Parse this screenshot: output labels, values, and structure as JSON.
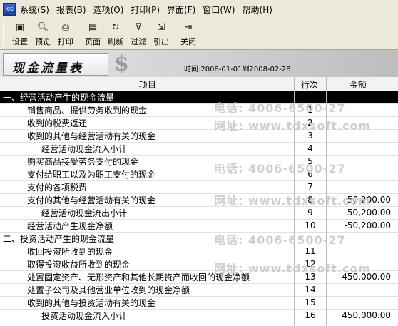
{
  "menubar": {
    "app_icon": "KIS",
    "items": [
      "系统(S)",
      "报表(B)",
      "选项(O)",
      "打印(P)",
      "界面(F)",
      "窗口(W)",
      "帮助(H)"
    ]
  },
  "toolbar": {
    "buttons": [
      {
        "label": "设置",
        "icon": "settings-icon"
      },
      {
        "label": "预览",
        "icon": "preview-icon"
      },
      {
        "label": "打印",
        "icon": "print-icon"
      },
      {
        "label": "页面",
        "icon": "page-icon"
      },
      {
        "label": "刷新",
        "icon": "refresh-icon"
      },
      {
        "label": "过滤",
        "icon": "filter-icon"
      },
      {
        "label": "引出",
        "icon": "export-icon"
      },
      {
        "label": "关闭",
        "icon": "close-icon"
      }
    ]
  },
  "report": {
    "title": "现金流量表",
    "time_label": "时间:2008-01-01到2008-02-28"
  },
  "table": {
    "headers": {
      "item": "项目",
      "line": "行次",
      "amount": "金额"
    },
    "rows": [
      {
        "item": "一、经营活动产生的现金流量",
        "line": "",
        "amount": "",
        "indent": 0,
        "selected": true
      },
      {
        "item": "销售商品、提供劳务收到的现金",
        "line": "1",
        "amount": "",
        "indent": 1
      },
      {
        "item": "收到的税费返还",
        "line": "2",
        "amount": "",
        "indent": 1
      },
      {
        "item": "收到的其他与经营活动有关的现金",
        "line": "3",
        "amount": "",
        "indent": 1
      },
      {
        "item": "经营活动现金流入小计",
        "line": "4",
        "amount": "",
        "indent": 2
      },
      {
        "item": "购买商品接受劳务支付的现金",
        "line": "5",
        "amount": "",
        "indent": 1
      },
      {
        "item": "支付给职工以及为职工支付的现金",
        "line": "6",
        "amount": "",
        "indent": 1
      },
      {
        "item": "支付的各项税费",
        "line": "7",
        "amount": "",
        "indent": 1
      },
      {
        "item": "支付的其他与经营活动有关的现金",
        "line": "8",
        "amount": "50,200.00",
        "indent": 1
      },
      {
        "item": "经营活动现金流出小计",
        "line": "9",
        "amount": "50,200.00",
        "indent": 2
      },
      {
        "item": "经营活动产生现金净额",
        "line": "10",
        "amount": "-50,200.00",
        "indent": 1
      },
      {
        "item": "二、投资活动产生的现金流量",
        "line": "",
        "amount": "",
        "indent": 0
      },
      {
        "item": "收回投资所收到的现金",
        "line": "11",
        "amount": "",
        "indent": 1
      },
      {
        "item": "取得投资收益所收到的现金",
        "line": "12",
        "amount": "",
        "indent": 1
      },
      {
        "item": "处置固定资产、无形资产和其他长期资产而收回的现金净额",
        "line": "13",
        "amount": "450,000.00",
        "indent": 1
      },
      {
        "item": "处置子公司及其他营业单位收到的现金净额",
        "line": "14",
        "amount": "",
        "indent": 1
      },
      {
        "item": "收到的其他与投资活动有关的现金",
        "line": "15",
        "amount": "",
        "indent": 1
      },
      {
        "item": "投资活动现金流入小计",
        "line": "16",
        "amount": "450,000.00",
        "indent": 2
      }
    ]
  },
  "watermarks": [
    "电话: 4006-6500-27",
    "网址: www.tdxsoft.com"
  ]
}
